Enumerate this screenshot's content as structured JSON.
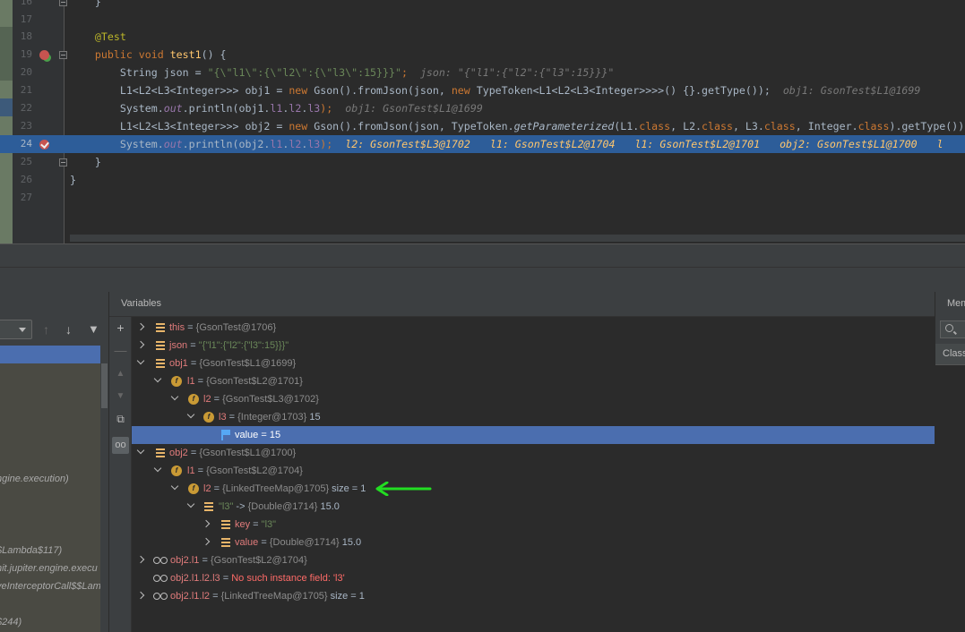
{
  "editor": {
    "lines": [
      {
        "num": "16",
        "text": "    }"
      },
      {
        "num": "17",
        "text": ""
      },
      {
        "num": "18",
        "annotation": "@Test"
      },
      {
        "num": "19",
        "kw1": "public",
        "kw2": "void",
        "method": "test1",
        "rest": "() {"
      },
      {
        "num": "20",
        "part1": "String json = ",
        "str": "\"{\\\"l1\\\":{\\\"l2\\\":{\\\"l3\\\":15}}}\"",
        "part2": ";",
        "inline": "json: \"{\"l1\":{\"l2\":{\"l3\":15}}}\""
      },
      {
        "num": "21",
        "part1": "L1<L2<L3<Integer>>> obj1 = ",
        "kw": "new",
        "part2": " Gson().fromJson(json, ",
        "kw2": "new",
        "part3": " TypeToken<L1<L2<L3<Integer>>>>() {}.getType());",
        "inline": "obj1: GsonTest$L1@1699"
      },
      {
        "num": "22",
        "part1": "System.",
        "fld": "out",
        "part2": ".println(obj1.",
        "f1": "l1",
        "d1": ".",
        "f2": "l2",
        "d2": ".",
        "f3": "l3",
        "part3": ");",
        "inline": "obj1: GsonTest$L1@1699"
      },
      {
        "num": "23",
        "part1": "L1<L2<L3<Integer>>> obj2 = ",
        "kw": "new",
        "part2": " Gson().fromJson(json, TypeToken.",
        "m": "getParameterized",
        "part3": "(L1.",
        "c1": "class",
        "part4": ", L2.",
        "c2": "class",
        "part5": ", L3.",
        "c3": "class",
        "part6": ", Integer.",
        "c4": "class",
        "part7": ").getType());"
      },
      {
        "num": "24",
        "part1": "System.",
        "fld": "out",
        "part2": ".println(obj2.",
        "f1": "l1",
        "d1": ".",
        "f2": "l2",
        "d2": ".",
        "f3": "l3",
        "part3": ");",
        "inl1": "l2: GsonTest$L3@1702",
        "inl2": "l1: GsonTest$L2@1704",
        "inl3": "l1: GsonTest$L2@1701",
        "inl4": "obj2: GsonTest$L1@1700",
        "inl5": "l"
      },
      {
        "num": "25",
        "text": "    }"
      },
      {
        "num": "26",
        "text": "}"
      },
      {
        "num": "27",
        "text": ""
      }
    ]
  },
  "frames": {
    "items": [
      "ngine.execution)",
      ")",
      "$Lambda$117)",
      "nit.jupiter.engine.execu",
      "veInterceptorCall$$Lam",
      "$244)"
    ]
  },
  "variables": {
    "title": "Variables",
    "rows": [
      {
        "name": "this",
        "eq": " = ",
        "type": "{GsonTest@1706}"
      },
      {
        "name": "json",
        "eq": " = ",
        "str": "\"{\"l1\":{\"l2\":{\"l3\":15}}}\""
      },
      {
        "name": "obj1",
        "eq": " = ",
        "type": "{GsonTest$L1@1699}"
      },
      {
        "name": "l1",
        "eq": " = ",
        "type": "{GsonTest$L2@1701}"
      },
      {
        "name": "l2",
        "eq": " = ",
        "type": "{GsonTest$L3@1702}"
      },
      {
        "name": "l3",
        "eq": " = ",
        "type": "{Integer@1703}",
        "val": " 15"
      },
      {
        "name": "value",
        "eq": " = ",
        "val": "15"
      },
      {
        "name": "obj2",
        "eq": " = ",
        "type": "{GsonTest$L1@1700}"
      },
      {
        "name": "l1",
        "eq": " = ",
        "type": "{GsonTest$L2@1704}"
      },
      {
        "name": "l2",
        "eq": " = ",
        "type": "{LinkedTreeMap@1705}",
        "val": " size = 1"
      },
      {
        "str": "\"l3\"",
        "eq": " -> ",
        "type": "{Double@1714}",
        "val": " 15.0"
      },
      {
        "name": "key",
        "eq": " = ",
        "str": "\"l3\""
      },
      {
        "name": "value",
        "eq": " = ",
        "type": "{Double@1714}",
        "val": " 15.0"
      },
      {
        "name": "obj2.l1",
        "eq": " = ",
        "type": "{GsonTest$L2@1704}"
      },
      {
        "name": "obj2.l1.l2.l3",
        "eq": " = ",
        "err": "No such instance field: 'l3'"
      },
      {
        "name": "obj2.l1.l2",
        "eq": " = ",
        "type": "{LinkedTreeMap@1705}",
        "val": " size = 1"
      }
    ]
  },
  "memory": {
    "title": "Memory",
    "column": "Class"
  },
  "colors": {
    "accent": "#4b6eaf",
    "highlight_line": "#2d5d99",
    "arrow": "#22dd22"
  }
}
